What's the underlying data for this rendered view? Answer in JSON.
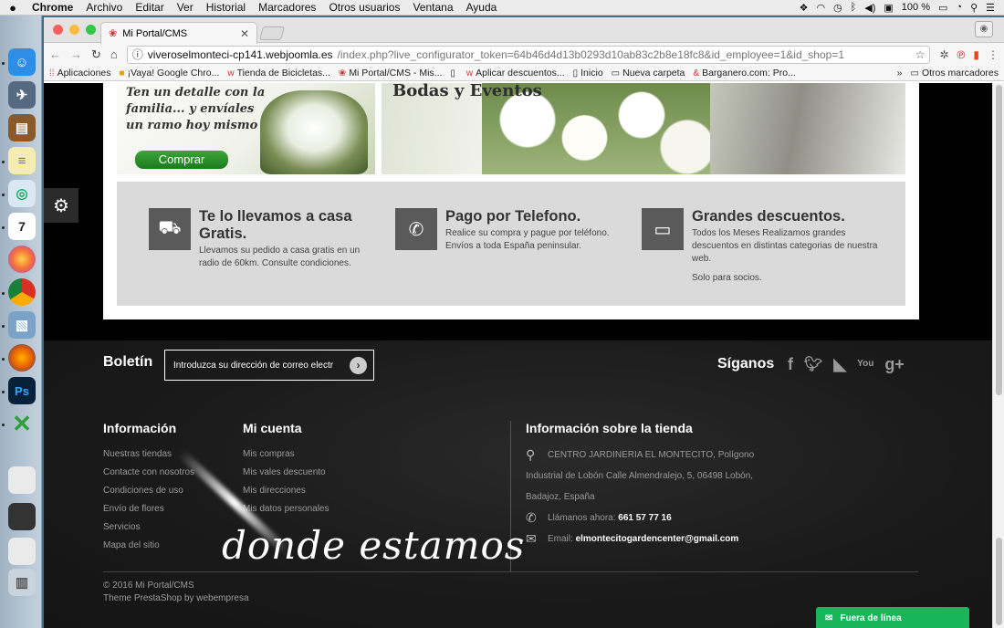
{
  "menubar": {
    "apple": "",
    "app": "Chrome",
    "items": [
      "Archivo",
      "Editar",
      "Ver",
      "Historial",
      "Marcadores",
      "Otros usuarios",
      "Ventana",
      "Ayuda"
    ],
    "battery": "100 %"
  },
  "browser": {
    "tab_title": "Mi Portal/CMS",
    "url_host": "viveroselmonteci-cp141.webjoomla.es",
    "url_path": "/index.php?live_configurator_token=64b46d4d13b0293d10ab83c2b8e18fc8&id_employee=1&id_shop=1",
    "bookmarks": [
      {
        "icon": "grid-icon",
        "label": "Aplicaciones"
      },
      {
        "icon": "favicon-icon",
        "label": "¡Vaya! Google Chro..."
      },
      {
        "icon": "w-icon",
        "label": "Tienda de Bicicletas..."
      },
      {
        "icon": "cms-icon",
        "label": "Mi Portal/CMS - Mis..."
      },
      {
        "icon": "page-icon",
        "label": ""
      },
      {
        "icon": "w-icon",
        "label": "Aplicar descuentos..."
      },
      {
        "icon": "page-icon",
        "label": "Inicio"
      },
      {
        "icon": "folder-icon",
        "label": "Nueva carpeta"
      },
      {
        "icon": "b-icon",
        "label": "Barganero.com: Pro..."
      }
    ],
    "more": "»",
    "other_bookmarks": "Otros marcadores"
  },
  "banners": {
    "left_text": [
      "Ten un detalle con la",
      "familia... y envíales",
      "un ramo hoy mismo"
    ],
    "buy_label": "Comprar",
    "right_title": "Bodas y Eventos"
  },
  "info_blocks": [
    {
      "icon": "truck-icon",
      "title": "Te lo llevamos a casa Gratis.",
      "text": "Llevamos su pedido a casa gratis en un radio de 60km. Consulte condiciones.",
      "extra": ""
    },
    {
      "icon": "phone-icon",
      "title": "Pago por Telefono.",
      "text": "Realice su compra y pague por teléfono. Envíos a toda España peninsular.",
      "extra": ""
    },
    {
      "icon": "card-icon",
      "title": "Grandes descuentos.",
      "text": "Todos los Meses Realizamos grandes descuentos en distintas categorias de nuestra web.",
      "extra": "Solo para socios."
    }
  ],
  "footer": {
    "newsletter_title": "Boletín",
    "newsletter_placeholder": "Introduzca su dirección de correo electr",
    "follow_title": "Síganos",
    "social": [
      "f",
      "t",
      "rss",
      "You",
      "g+"
    ],
    "info_title": "Información",
    "info_links": [
      "Nuestras tiendas",
      "Contacte con nosotros",
      "Condiciones de uso",
      "Envío de flores",
      "Servicios",
      "Mapa del sitio"
    ],
    "account_title": "Mi cuenta",
    "account_links": [
      "Mis compras",
      "Mis vales descuento",
      "Mis direcciones",
      "Mis datos personales"
    ],
    "store_title": "Información sobre la tienda",
    "address_line1": "CENTRO JARDINERIA EL MONTECITO, Polígono",
    "address_line2": "Industrial de Lobón Calle Almendralejo, 5, 06498 Lobón,",
    "address_line3": "Badajoz, España",
    "phone_label": "Llámanos ahora:",
    "phone": "661 57 77 16",
    "email_label": "Email:",
    "email": "elmontecitogardencenter@gmail.com",
    "script_text": "donde estamos",
    "copyright": "© 2016 Mi Portal/CMS",
    "theme": "Theme PrestaShop by webempresa",
    "chat_label": "Fuera de línea"
  }
}
